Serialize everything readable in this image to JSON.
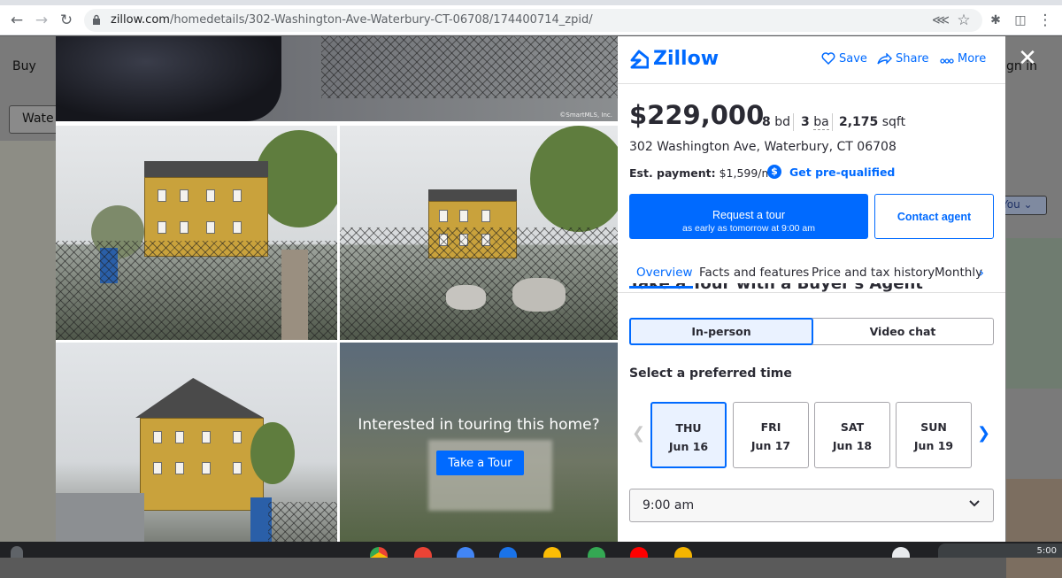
{
  "browser": {
    "url_host": "zillow.com",
    "url_path": "/homedetails/302-Washington-Ave-Waterbury-CT-06708/174400714_zpid/"
  },
  "background_page": {
    "nav_buy": "Buy",
    "sign_in": "gn in",
    "search_fragment": "Wate",
    "you_chip": "You"
  },
  "gallery": {
    "photo_credit": "©SmartMLS, Inc.",
    "tour_prompt": "Interested in touring this home?",
    "tour_button": "Take a Tour"
  },
  "header": {
    "logo": "Zillow",
    "save": "Save",
    "share": "Share",
    "more": "More"
  },
  "listing": {
    "price": "$229,000",
    "beds_value": "8",
    "beds_unit": "bd",
    "baths_value": "3",
    "baths_unit": "ba",
    "sqft_value": "2,175",
    "sqft_unit": "sqft",
    "address": "302 Washington Ave, Waterbury, CT 06708",
    "est_payment_label": "Est. payment:",
    "est_payment_value": "$1,599/mo",
    "prequal": "Get pre-qualified"
  },
  "actions": {
    "request_tour": "Request a tour",
    "request_tour_sub": "as early as tomorrow at 9:00 am",
    "contact_agent": "Contact agent"
  },
  "tabs": [
    {
      "label": "Overview"
    },
    {
      "label": "Facts and features"
    },
    {
      "label": "Price and tax history"
    },
    {
      "label": "Monthly"
    }
  ],
  "tour": {
    "cut_heading": "Take a Tour with a Buyer's Agent",
    "mode_inperson": "In-person",
    "mode_video": "Video chat",
    "select_time_label": "Select a preferred time",
    "days": [
      {
        "dow": "THU",
        "date": "Jun 16"
      },
      {
        "dow": "FRI",
        "date": "Jun 17"
      },
      {
        "dow": "SAT",
        "date": "Jun 18"
      },
      {
        "dow": "SUN",
        "date": "Jun 19"
      }
    ],
    "selected_time": "9:00 am"
  },
  "shelf": {
    "time": "5:00"
  },
  "colors": {
    "accent": "#006aff",
    "text": "#2a2a33"
  }
}
